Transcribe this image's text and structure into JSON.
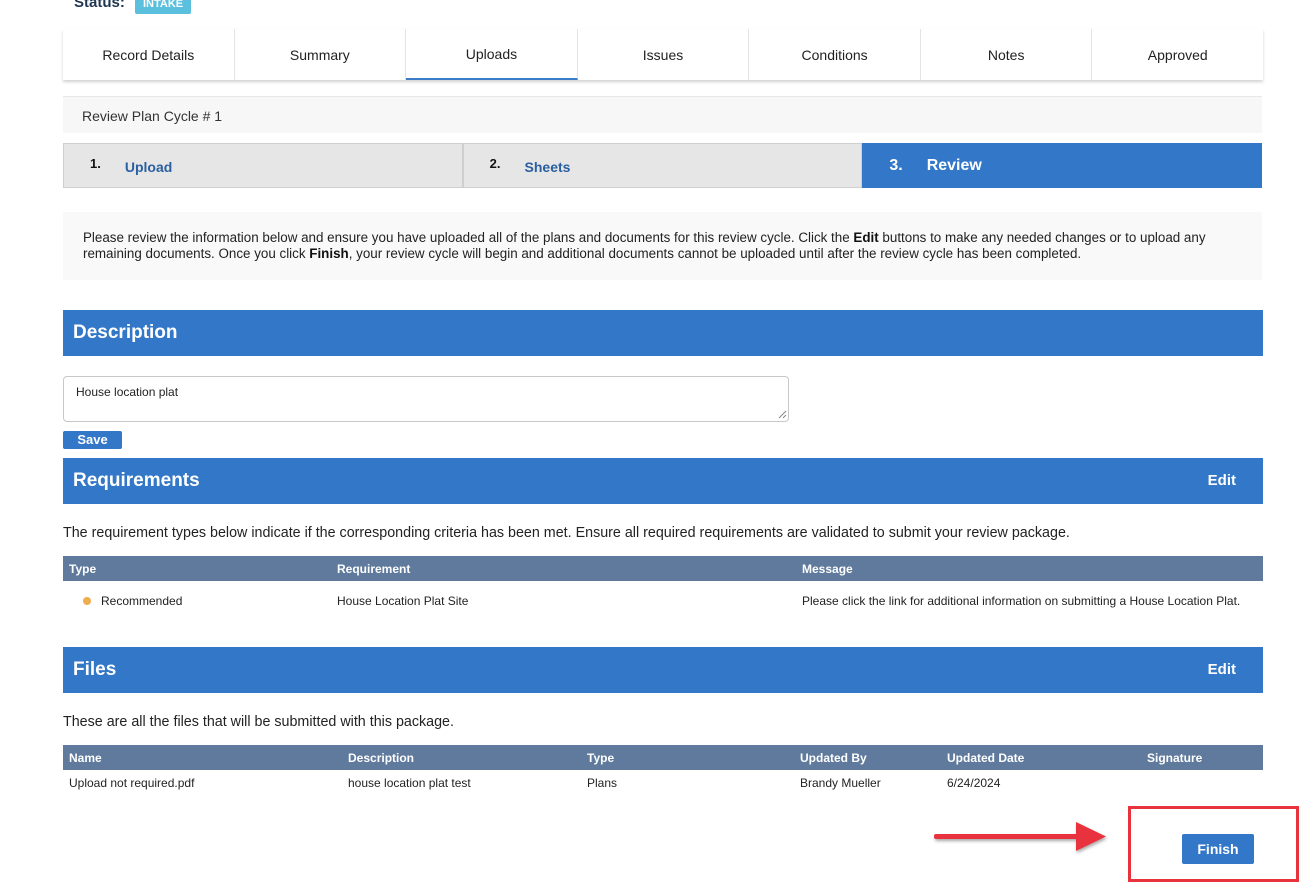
{
  "status": {
    "label": "Status:",
    "badge": "INTAKE"
  },
  "tabs": [
    {
      "label": "Record Details"
    },
    {
      "label": "Summary"
    },
    {
      "label": "Uploads",
      "active": true
    },
    {
      "label": "Issues"
    },
    {
      "label": "Conditions"
    },
    {
      "label": "Notes"
    },
    {
      "label": "Approved"
    }
  ],
  "cycle": {
    "title": "Review Plan Cycle # 1"
  },
  "steps": [
    {
      "num": "1.",
      "label": "Upload"
    },
    {
      "num": "2.",
      "label": "Sheets"
    },
    {
      "num": "3.",
      "label": "Review",
      "active": true
    }
  ],
  "info": {
    "part1": "Please review the information below and ensure you have uploaded all of the plans and documents for this review cycle. Click the ",
    "bold1": "Edit",
    "part2": " buttons to make any needed changes or to upload any remaining documents. Once you click ",
    "bold2": "Finish",
    "part3": ", your review cycle will begin and additional documents cannot be uploaded until after the review cycle has been completed."
  },
  "description": {
    "title": "Description",
    "value": "House location plat",
    "save_label": "Save"
  },
  "requirements": {
    "title": "Requirements",
    "edit_label": "Edit",
    "note": "The requirement types below indicate if the corresponding criteria has been met. Ensure all required requirements are validated to submit your review package.",
    "columns": [
      "Type",
      "Requirement",
      "Message"
    ],
    "rows": [
      {
        "type": "Recommended",
        "requirement": "House Location Plat Site",
        "message": "Please click the link for additional information on submitting a House Location Plat."
      }
    ],
    "status_color": "#f0ad4e"
  },
  "files": {
    "title": "Files",
    "edit_label": "Edit",
    "note": "These are all the files that will be submitted with this package.",
    "columns": [
      "Name",
      "Description",
      "Type",
      "Updated By",
      "Updated Date",
      "Signature"
    ],
    "rows": [
      {
        "name": "Upload not required.pdf",
        "description": "house location plat test",
        "type": "Plans",
        "updated_by": "Brandy Mueller",
        "updated_date": "6/24/2024",
        "signature": ""
      }
    ]
  },
  "finish": {
    "label": "Finish"
  },
  "colors": {
    "accent": "#3277c8",
    "table_header": "#5f7a9c",
    "highlight": "#e8323c",
    "badge": "#5bc0de"
  }
}
